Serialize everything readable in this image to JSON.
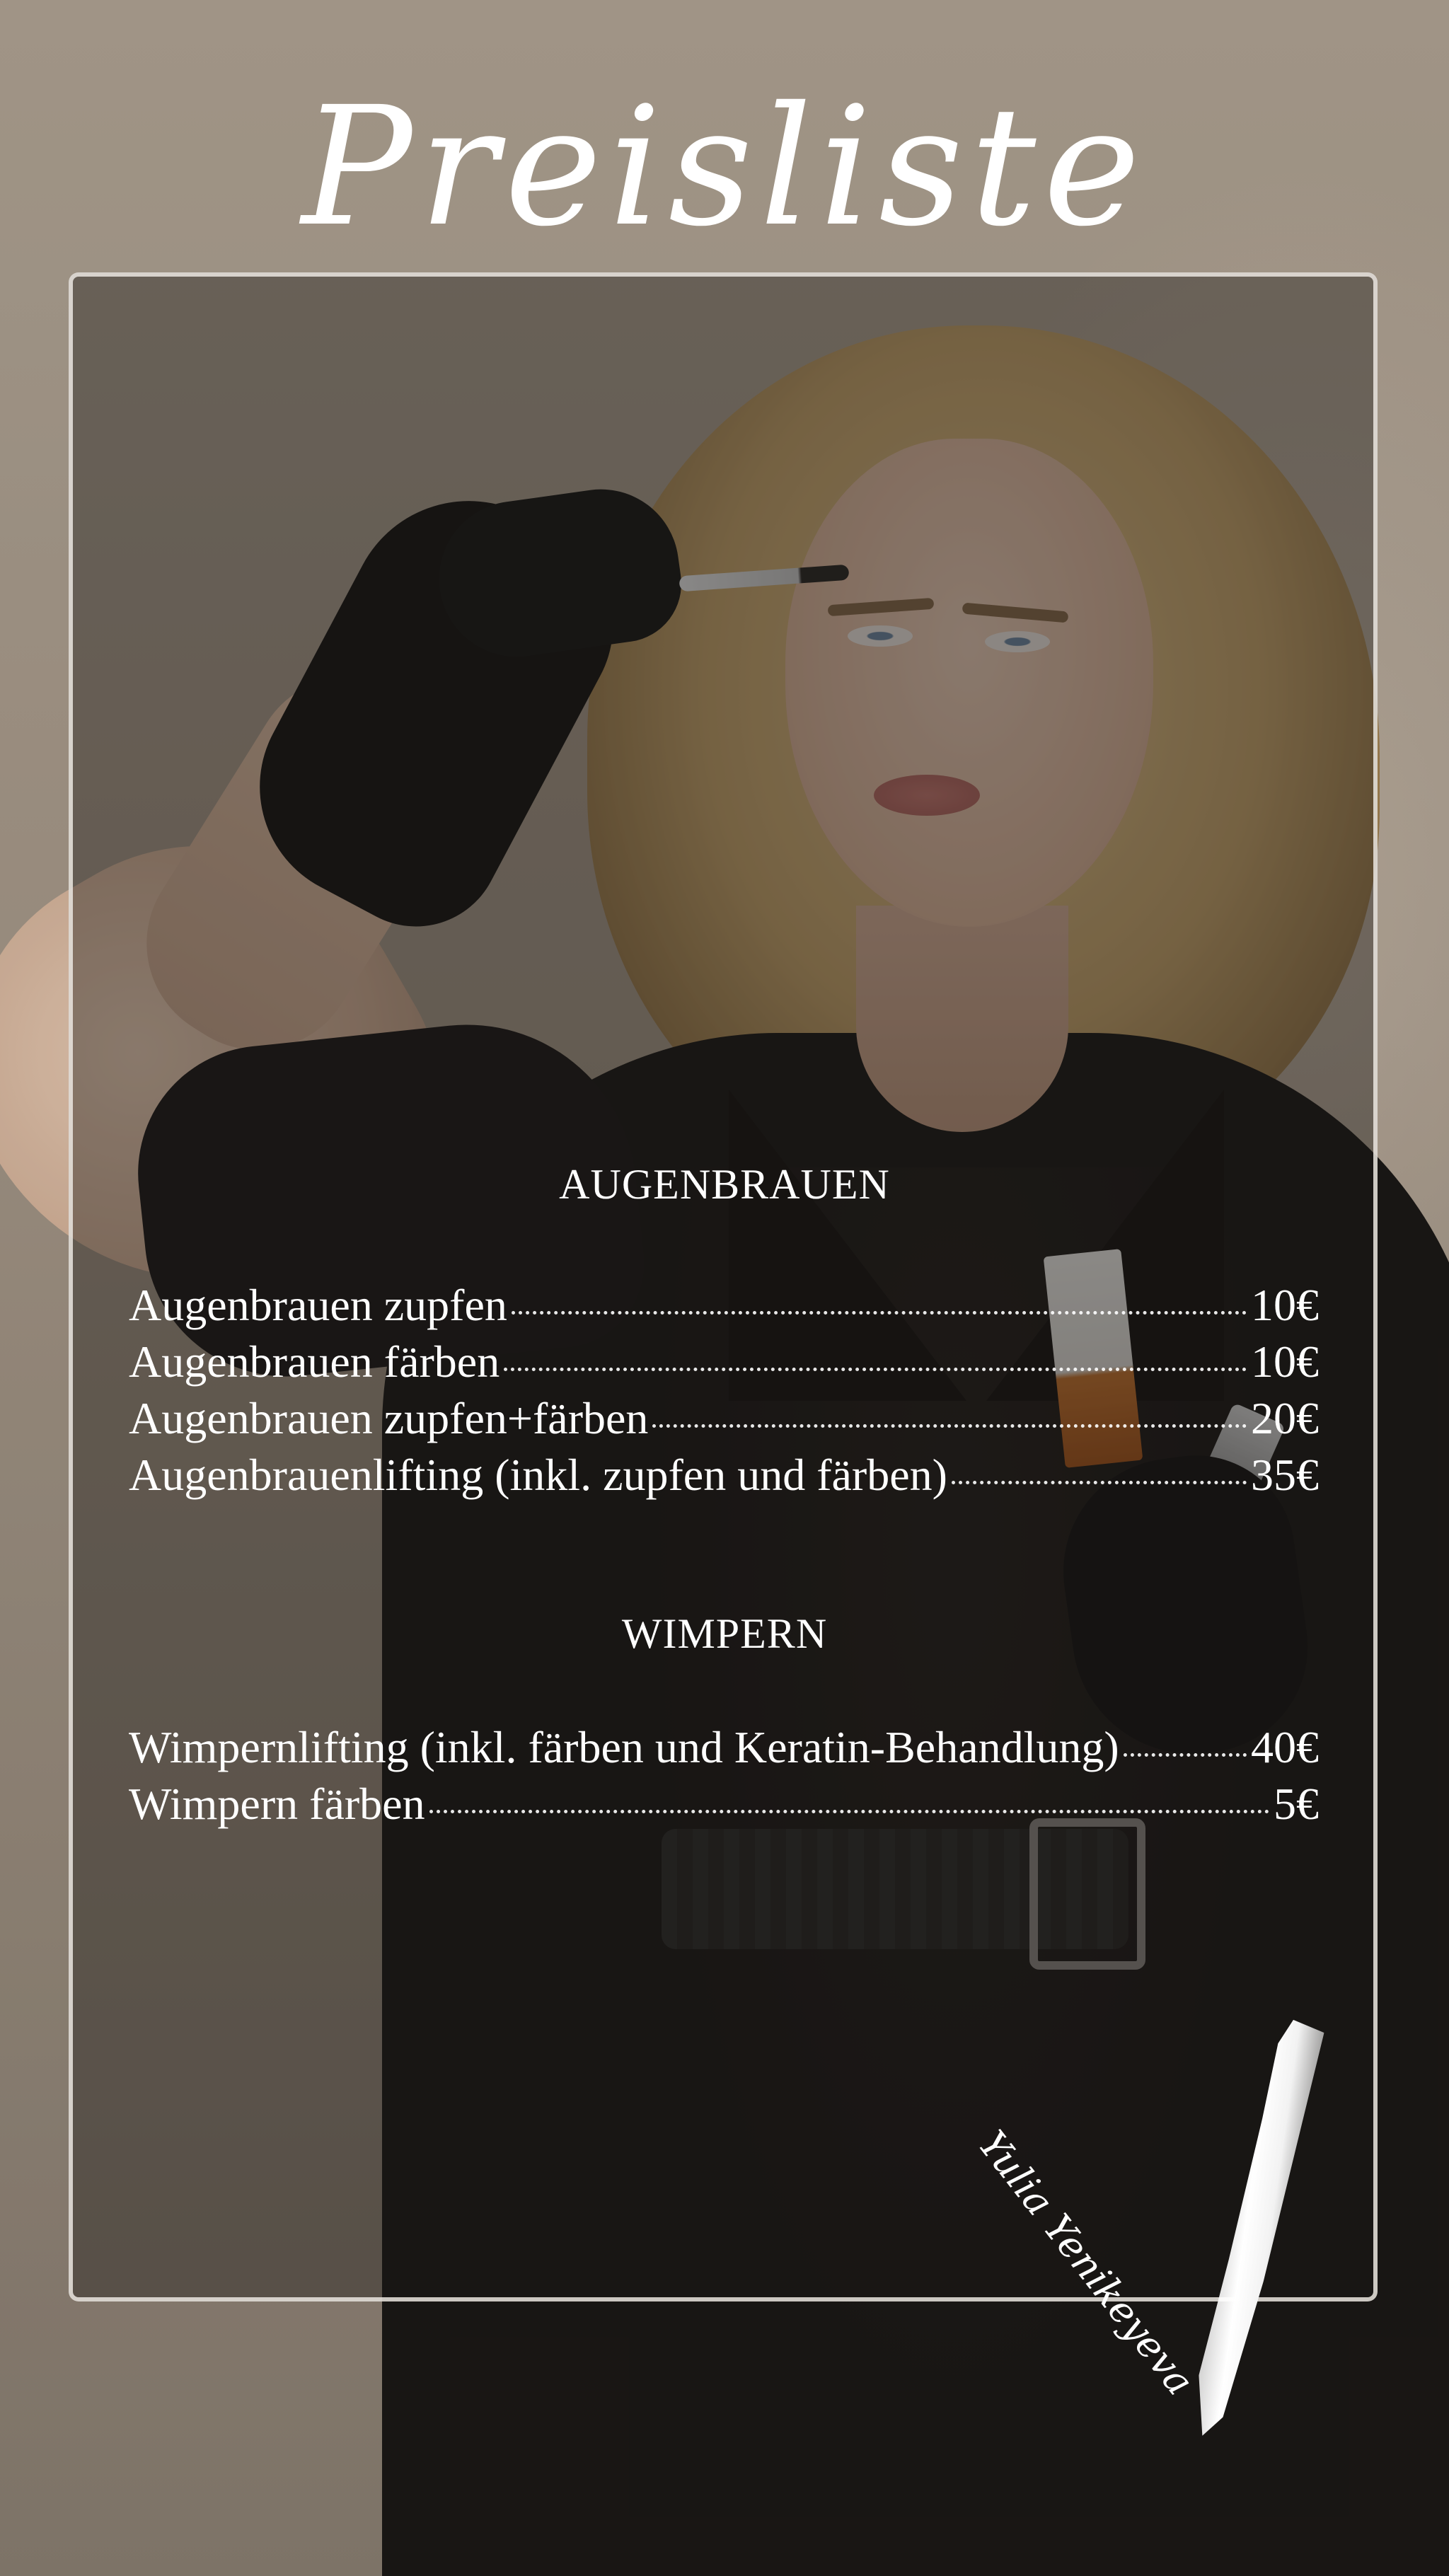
{
  "title": "Preisliste",
  "sections": [
    {
      "heading": "AUGENBRAUEN",
      "items": [
        {
          "name": "Augenbrauen zupfen",
          "price": "10€"
        },
        {
          "name": "Augenbrauen färben",
          "price": "10€"
        },
        {
          "name": "Augenbrauen zupfen+färben",
          "price": "20€"
        },
        {
          "name": "Augenbrauenlifting (inkl. zupfen und färben)",
          "price": "35€"
        }
      ]
    },
    {
      "heading": "WIMPERN",
      "items": [
        {
          "name": "Wimpernlifting (inkl. färben und Keratin-Behandlung)",
          "price": "40€"
        },
        {
          "name": "Wimpern färben",
          "price": "5€"
        }
      ]
    }
  ],
  "signature": "Yulia Yenikeyeva"
}
